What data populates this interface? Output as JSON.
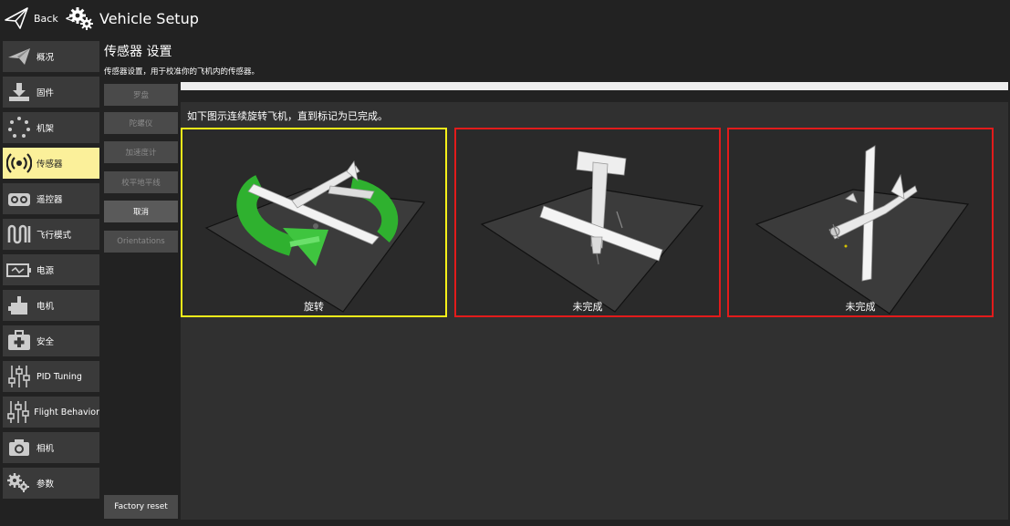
{
  "header": {
    "back_label": "Back",
    "separator": "<",
    "title": "Vehicle Setup"
  },
  "sidebar": {
    "items": [
      {
        "label": "概况",
        "icon": "plane-icon"
      },
      {
        "label": "固件",
        "icon": "download-icon"
      },
      {
        "label": "机架",
        "icon": "airframe-icon"
      },
      {
        "label": "传感器",
        "icon": "sensors-icon"
      },
      {
        "label": "遥控器",
        "icon": "radio-icon"
      },
      {
        "label": "飞行模式",
        "icon": "flight-modes-icon"
      },
      {
        "label": "电源",
        "icon": "battery-icon"
      },
      {
        "label": "电机",
        "icon": "motor-icon"
      },
      {
        "label": "安全",
        "icon": "safety-icon"
      },
      {
        "label": "PID Tuning",
        "icon": "sliders-icon"
      },
      {
        "label": "Flight Behavior",
        "icon": "sliders-icon"
      },
      {
        "label": "相机",
        "icon": "camera-icon"
      },
      {
        "label": "参数",
        "icon": "gears-icon"
      }
    ],
    "active_index": 3
  },
  "main": {
    "title": "传感器 设置",
    "description": "传感器设置，用于校准你的飞机内的传感器。",
    "instruction": "如下图示连续旋转飞机，直到标记为已完成。"
  },
  "calibration_buttons": [
    {
      "label": "罗盘",
      "enabled": false
    },
    {
      "label": "陀螺仪",
      "enabled": false
    },
    {
      "label": "加速度计",
      "enabled": false
    },
    {
      "label": "校平地平线",
      "enabled": false
    },
    {
      "label": "取消",
      "enabled": true
    },
    {
      "label": "Orientations",
      "enabled": false
    }
  ],
  "factory_reset": "Factory reset",
  "progress": {
    "value": 0
  },
  "tiles": [
    {
      "label": "旋转",
      "state": "rotating",
      "border_color": "#f5f01a"
    },
    {
      "label": "未完成",
      "state": "incomplete",
      "border_color": "#e21b1b"
    },
    {
      "label": "未完成",
      "state": "incomplete",
      "border_color": "#e21b1b"
    }
  ],
  "colors": {
    "background": "#222222",
    "active_item": "#fbf09a",
    "rotate_arrow": "#2fb12f"
  }
}
